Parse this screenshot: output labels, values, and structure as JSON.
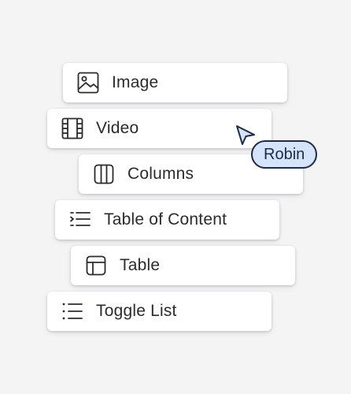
{
  "menu": {
    "items": [
      {
        "label": "Image",
        "icon": "image-icon"
      },
      {
        "label": "Video",
        "icon": "film-icon"
      },
      {
        "label": "Columns",
        "icon": "columns-icon"
      },
      {
        "label": "Table of Content",
        "icon": "table-of-contents-icon"
      },
      {
        "label": "Table",
        "icon": "table-icon"
      },
      {
        "label": "Toggle List",
        "icon": "toggle-list-icon"
      }
    ]
  },
  "collaborator": {
    "name": "Robin",
    "cursor_icon": "pointer-cursor-icon",
    "color": "#d6e4fb",
    "outline": "#1f2a44"
  }
}
